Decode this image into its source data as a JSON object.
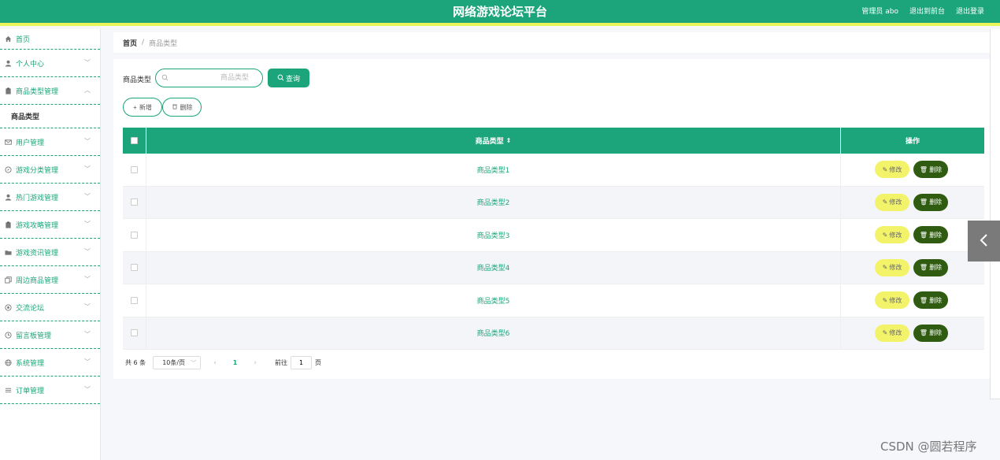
{
  "header": {
    "title": "网络游戏论坛平台",
    "user_label": "管理员 abo",
    "to_front_label": "退出到前台",
    "logout_label": "退出登录"
  },
  "sidebar": {
    "home_label": "首页",
    "items": [
      {
        "label": "个人中心",
        "icon": "user-icon"
      },
      {
        "label": "商品类型管理",
        "icon": "clipboard-icon",
        "expanded": true
      },
      {
        "label": "用户管理",
        "icon": "mail-icon"
      },
      {
        "label": "游戏分类管理",
        "icon": "compass-icon"
      },
      {
        "label": "热门游戏管理",
        "icon": "user-icon"
      },
      {
        "label": "游戏攻略管理",
        "icon": "clipboard-icon"
      },
      {
        "label": "游戏资讯管理",
        "icon": "folder-icon"
      },
      {
        "label": "周边商品管理",
        "icon": "copy-icon"
      },
      {
        "label": "交流论坛",
        "icon": "soccer-icon"
      },
      {
        "label": "留言板管理",
        "icon": "clock-icon"
      },
      {
        "label": "系统管理",
        "icon": "globe-icon"
      },
      {
        "label": "订单管理",
        "icon": "list-icon"
      }
    ],
    "submenu_label": "商品类型"
  },
  "breadcrumb": {
    "home": "首页",
    "separator": "/",
    "current": "商品类型"
  },
  "search": {
    "label": "商品类型",
    "placeholder": "商品类型",
    "query_label": "查询"
  },
  "toolbar": {
    "add_label": "新增",
    "delete_label": "删除"
  },
  "table": {
    "headers": {
      "name": "商品类型",
      "sort_icon": "⇕",
      "ops": "操作"
    },
    "rows": [
      {
        "name": "商品类型1"
      },
      {
        "name": "商品类型2"
      },
      {
        "name": "商品类型3"
      },
      {
        "name": "商品类型4"
      },
      {
        "name": "商品类型5"
      },
      {
        "name": "商品类型6"
      }
    ],
    "edit_label": "修改",
    "row_delete_label": "删除"
  },
  "pagination": {
    "total": "共 6 条",
    "page_size": "10条/页",
    "current_page": "1",
    "goto_label": "前往",
    "goto_value": "1",
    "unit_label": "页"
  },
  "watermark": "CSDN @圆若程序",
  "colors": {
    "primary": "#1ca57a",
    "accent_bar": "#e9f55a",
    "edit_button": "#f3f36a",
    "delete_button": "#2f5c10"
  }
}
